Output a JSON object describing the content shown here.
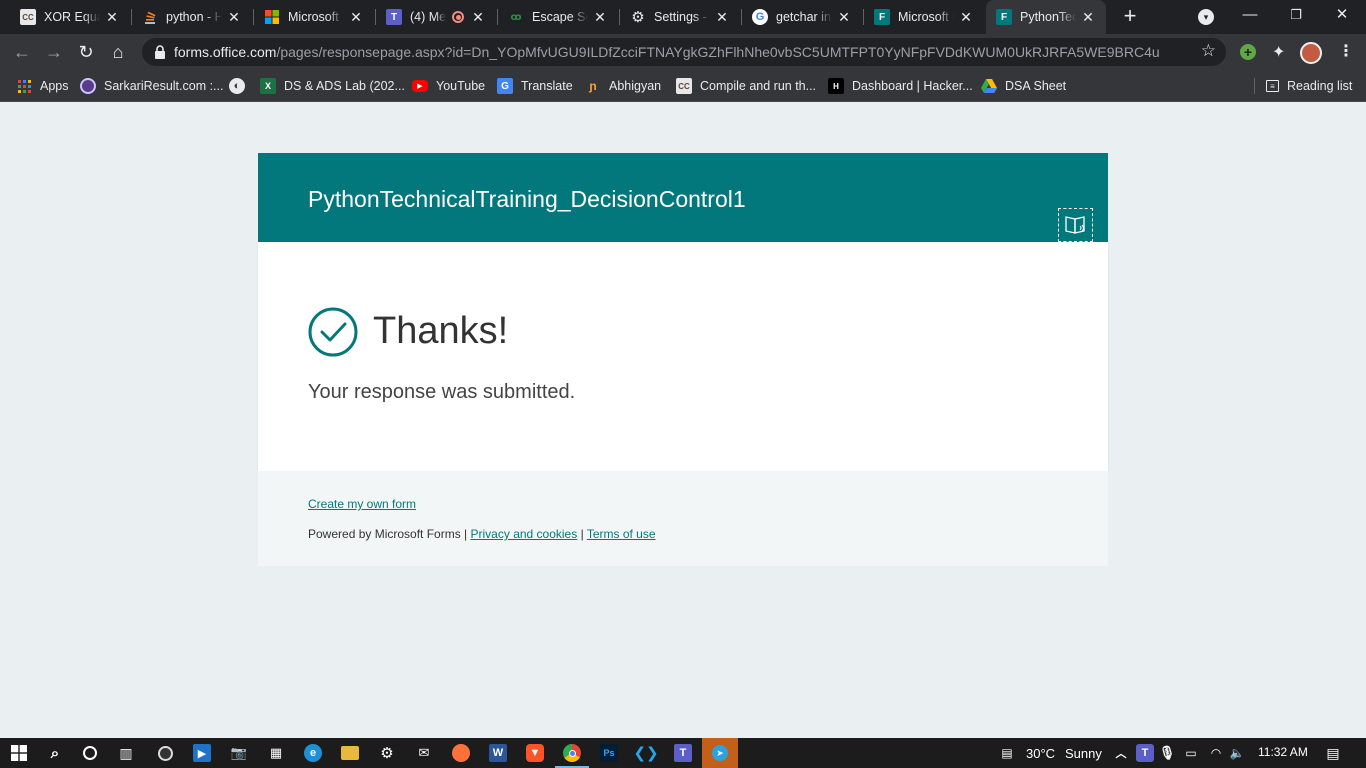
{
  "browser": {
    "tabs": [
      {
        "title": "XOR Equal",
        "icon": "codechef-icon",
        "favicon_text": "CC"
      },
      {
        "title": "python - H",
        "icon": "stackoverflow-icon",
        "favicon_text": ""
      },
      {
        "title": "Microsoft T",
        "icon": "microsoft-icon",
        "favicon_text": ""
      },
      {
        "title": "(4) Me",
        "icon": "teams-icon",
        "favicon_text": "T"
      },
      {
        "title": "Escape Seq",
        "icon": "geeksforgeeks-icon",
        "favicon_text": "GG"
      },
      {
        "title": "Settings - I",
        "icon": "settings-gear-icon",
        "favicon_text": "⚙"
      },
      {
        "title": "getchar in",
        "icon": "google-icon",
        "favicon_text": "G"
      },
      {
        "title": "Microsoft F",
        "icon": "forms-icon",
        "favicon_text": "F"
      },
      {
        "title": "PythonTech",
        "icon": "forms-icon",
        "favicon_text": "F"
      }
    ],
    "url": {
      "host": "forms.office.com",
      "path": "/pages/responsepage.aspx?id=Dn_YOpMfvUGU9ILDfZcciFTNAYgkGZhFlhNhe0vbSC5UMTFPT0YyNFpFVDdKWUM0UkRJRFA5WE9BRC4u"
    },
    "bookmarks": [
      {
        "label": "Apps",
        "icon": "apps-grid-icon"
      },
      {
        "label": "SarkariResult.com :...",
        "icon": "sarkari-icon"
      },
      {
        "label": "",
        "icon": "globe-icon"
      },
      {
        "label": "DS & ADS Lab (202...",
        "icon": "excel-icon"
      },
      {
        "label": "YouTube",
        "icon": "youtube-icon"
      },
      {
        "label": "Translate",
        "icon": "translate-icon"
      },
      {
        "label": "Abhigyan",
        "icon": "abhigyan-icon"
      },
      {
        "label": "Compile and run th...",
        "icon": "codechef-icon"
      },
      {
        "label": "Dashboard | Hacker...",
        "icon": "hackerrank-icon"
      },
      {
        "label": "DSA Sheet",
        "icon": "google-drive-icon"
      }
    ],
    "reading_list": "Reading list"
  },
  "form": {
    "title": "PythonTechnicalTraining_DecisionControl1",
    "thanks": "Thanks!",
    "message": "Your response was submitted.",
    "create_link": "Create my own form",
    "powered_by": "Powered by Microsoft Forms |",
    "privacy": "Privacy and cookies",
    "separator": "|",
    "terms": "Terms of use",
    "accent": "#03787c"
  },
  "taskbar": {
    "weather_temp": "30°C",
    "weather_desc": "Sunny",
    "time": "11:32 AM"
  }
}
